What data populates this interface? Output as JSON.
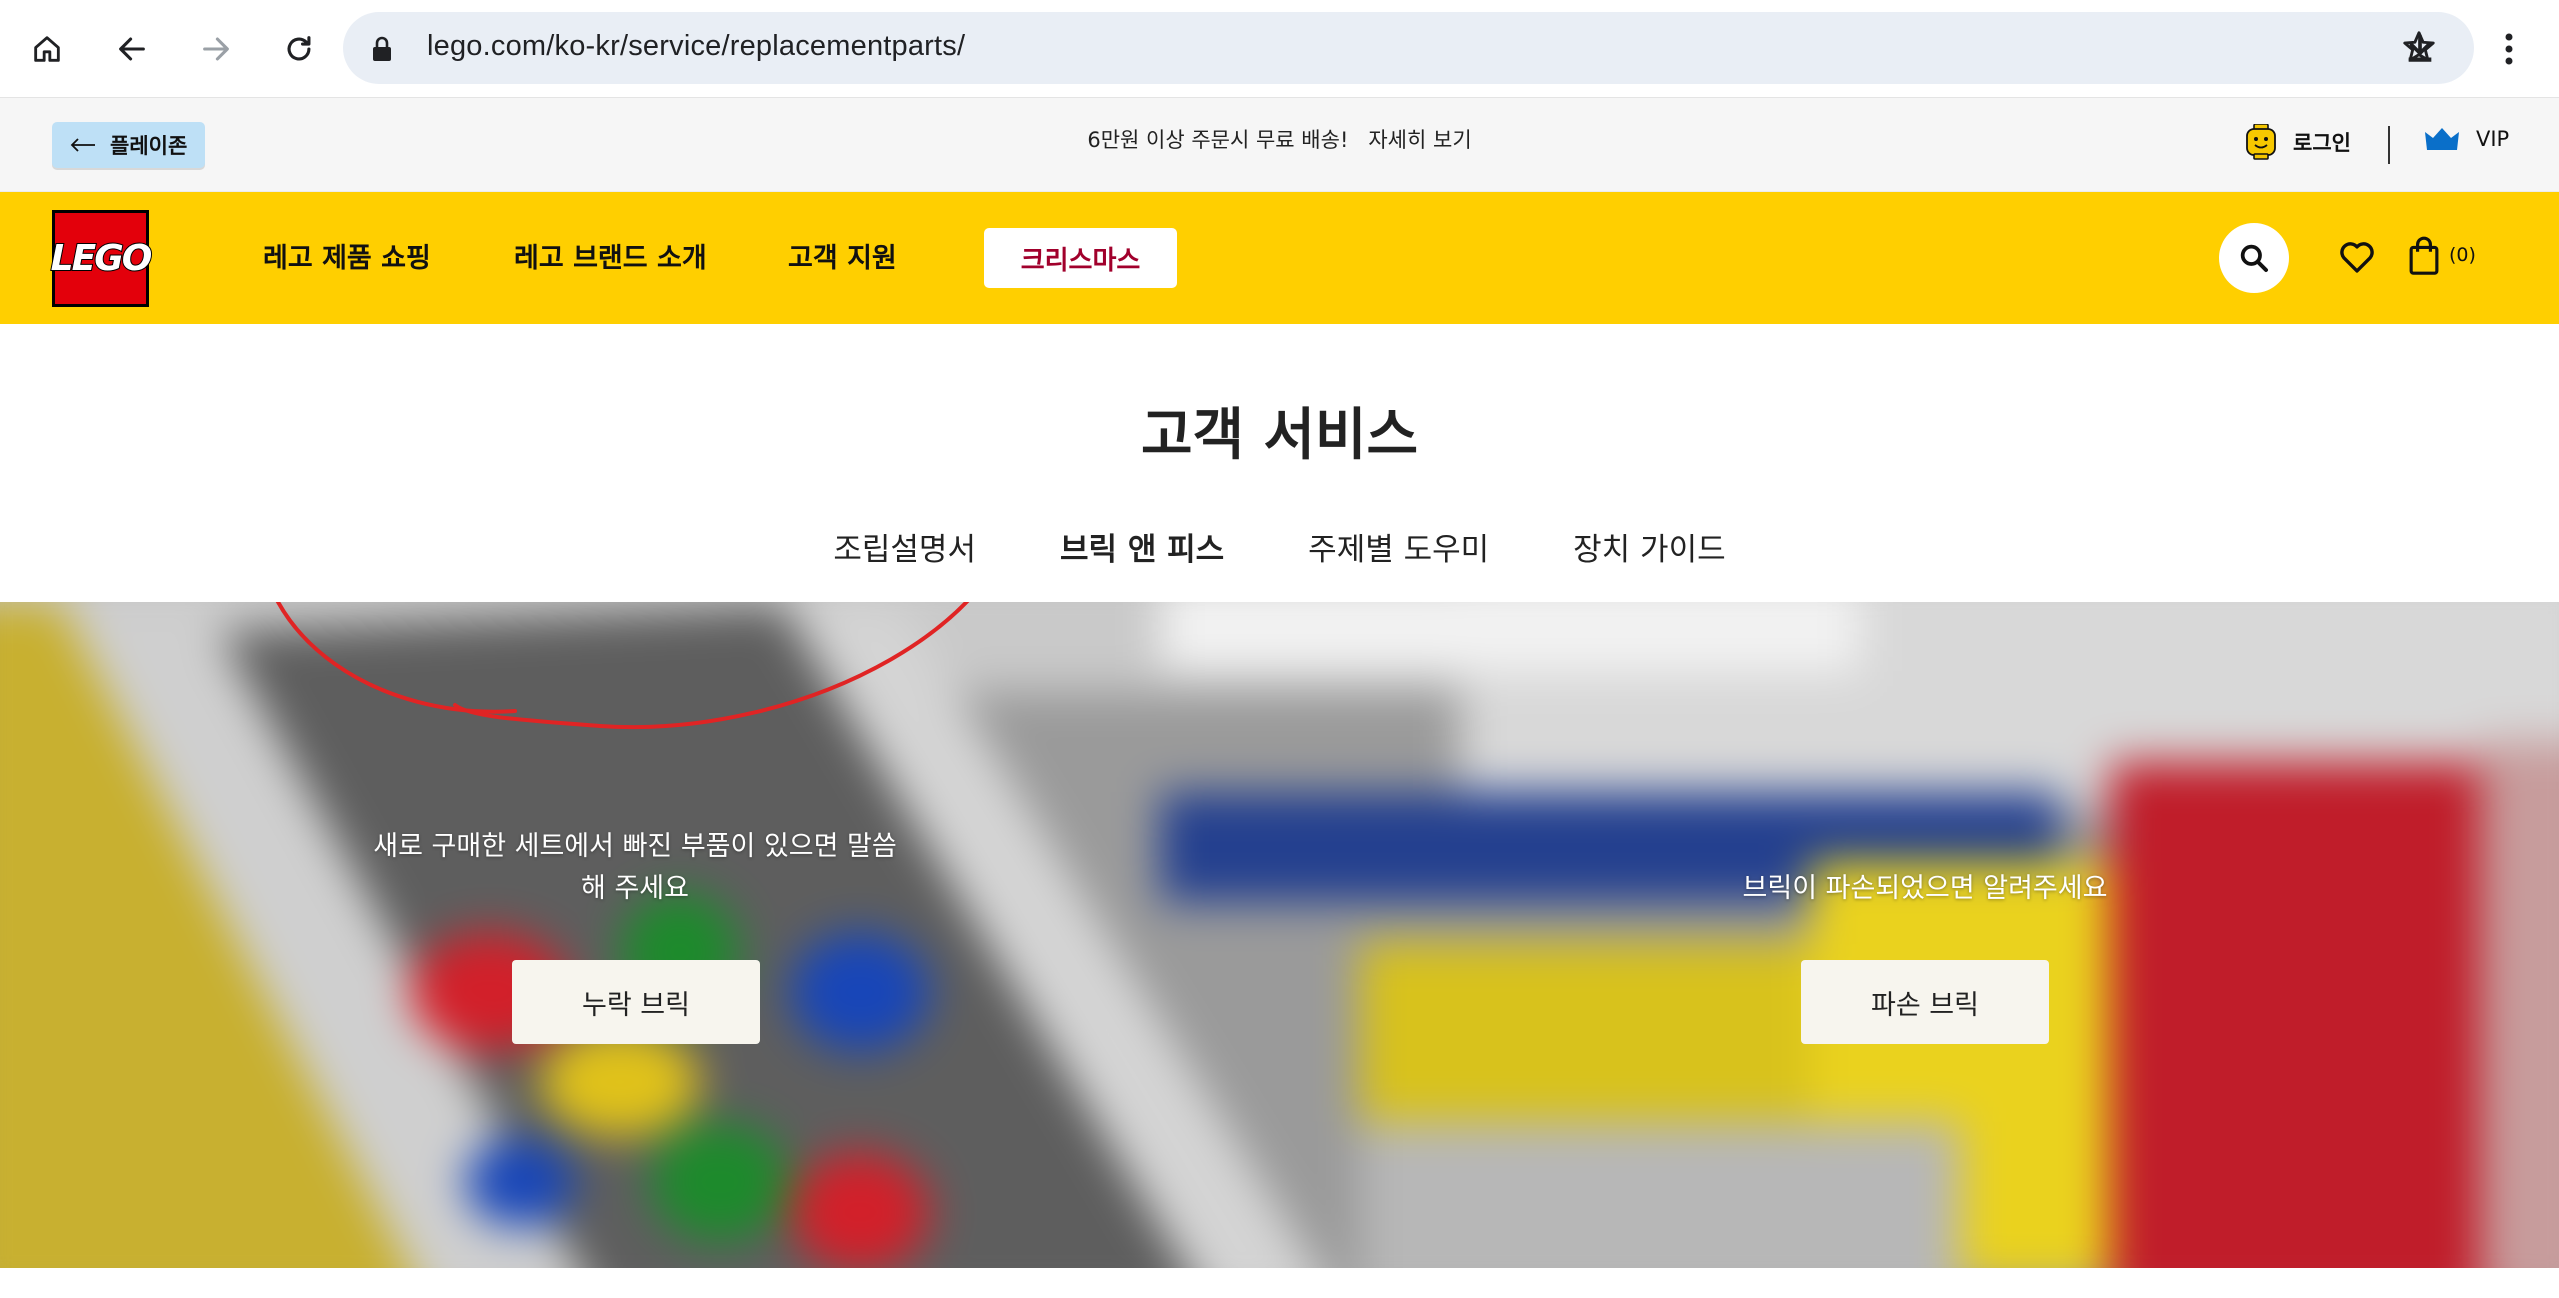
{
  "browser": {
    "url": "lego.com/ko-kr/service/replacementparts/",
    "icons": [
      "home-icon",
      "back-icon",
      "forward-icon",
      "reload-icon",
      "lock-icon",
      "star-icon",
      "download-icon",
      "more-icon"
    ]
  },
  "announcement": {
    "playzone_label": "플레이존",
    "shipping_text": "6만원 이상 주문시 무료 배송!",
    "details_link": "자세히 보기",
    "login_label": "로그인",
    "vip_label": "VIP"
  },
  "nav": {
    "logo_text": "LEGO",
    "items": [
      "레고 제품 쇼핑",
      "레고 브랜드 소개",
      "고객 지원"
    ],
    "christmas_label": "크리스마스",
    "cart_count": "(0)",
    "colors": {
      "nav_bg": "#ffcf00",
      "logo_red": "#e3000b",
      "christmas_text": "#a1002c"
    }
  },
  "page": {
    "title": "고객 서비스",
    "tabs": [
      {
        "label": "조립설명서",
        "active": false
      },
      {
        "label": "브릭 앤 피스",
        "active": true
      },
      {
        "label": "주제별 도우미",
        "active": false
      },
      {
        "label": "장치 가이드",
        "active": false
      }
    ]
  },
  "hero": {
    "missing": {
      "message_line1": "새로 구매한 세트에서 빠진 부품이 있으면 말씀",
      "message_line2": "해 주세요",
      "button_label": "누락 브릭"
    },
    "damaged": {
      "message": "브릭이 파손되었으면 알려주세요",
      "button_label": "파손 브릭"
    },
    "annotation_color": "#e02424"
  }
}
